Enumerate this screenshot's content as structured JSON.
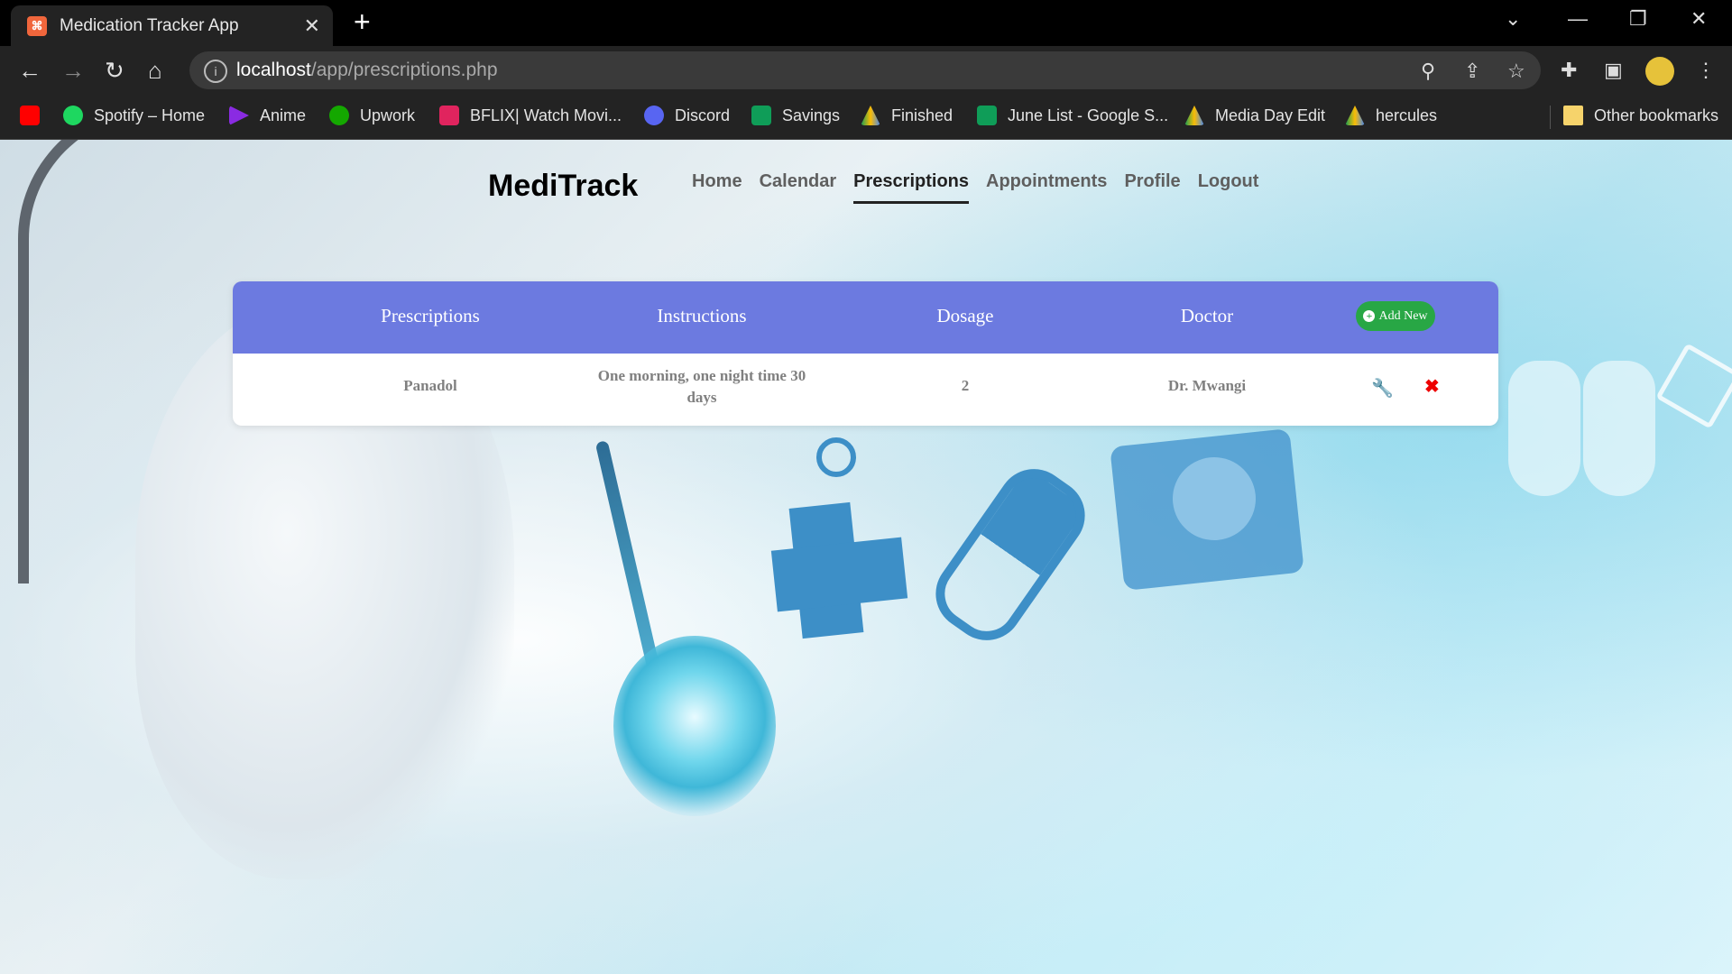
{
  "browser": {
    "tab_title": "Medication Tracker App",
    "url_host": "localhost",
    "url_path": "/app/prescriptions.php",
    "bookmarks": [
      {
        "label": "",
        "color": "#ff0000",
        "icon": "youtube-icon"
      },
      {
        "label": "Spotify – Home",
        "color": "#1ed760",
        "icon": "spotify-icon"
      },
      {
        "label": "Anime",
        "color": "#8a2be2",
        "icon": "play-icon"
      },
      {
        "label": "Upwork",
        "color": "#14a800",
        "icon": "upwork-icon"
      },
      {
        "label": "BFLIX| Watch Movi...",
        "color": "#e0245e",
        "icon": "bflix-icon"
      },
      {
        "label": "Discord",
        "color": "#5865f2",
        "icon": "discord-icon"
      },
      {
        "label": "Savings",
        "color": "#0f9d58",
        "icon": "sheets-icon"
      },
      {
        "label": "Finished",
        "color": "#fbbc04",
        "icon": "drive-icon"
      },
      {
        "label": "June List - Google S...",
        "color": "#0f9d58",
        "icon": "sheets-icon"
      },
      {
        "label": "Media Day Edit",
        "color": "#fbbc04",
        "icon": "drive-icon"
      },
      {
        "label": "hercules",
        "color": "#4285f4",
        "icon": "drive-icon"
      },
      {
        "label": "Other bookmarks",
        "color": "#f6d36b",
        "icon": "folder-icon"
      }
    ]
  },
  "app": {
    "brand": "MediTrack",
    "nav": [
      "Home",
      "Calendar",
      "Prescriptions",
      "Appointments",
      "Profile",
      "Logout"
    ],
    "active_nav": "Prescriptions",
    "accent_color": "#6c7ae0",
    "add_button_color": "#28a745"
  },
  "table": {
    "headers": [
      "Prescriptions",
      "Instructions",
      "Dosage",
      "Doctor"
    ],
    "add_label": "Add New",
    "rows": [
      {
        "prescription": "Panadol",
        "instructions": "One morning, one night time 30 days",
        "dosage": "2",
        "doctor": "Dr. Mwangi"
      }
    ]
  }
}
